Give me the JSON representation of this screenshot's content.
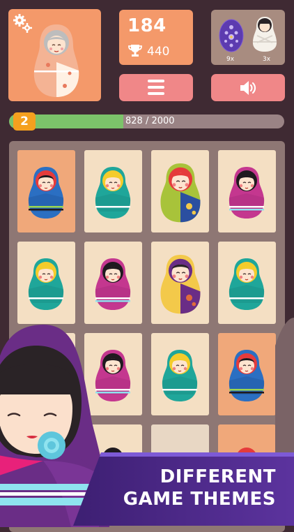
{
  "stats": {
    "score": "184",
    "best": "440"
  },
  "powerups": [
    {
      "name": "purple-egg",
      "count": "9x"
    },
    {
      "name": "white-doll",
      "count": "3x"
    }
  ],
  "level": {
    "number": "2",
    "progress_text": "828 / 2000",
    "progress_fraction": 0.414
  },
  "icons": {
    "settings": "gear-icon",
    "menu": "hamburger-icon",
    "sound": "speaker-icon",
    "trophy": "trophy-icon"
  },
  "banner": {
    "line1": "DIFFERENT",
    "line2": "GAME THEMES"
  },
  "board": {
    "rows": [
      [
        {
          "bg": "orange",
          "doll": "blue-red"
        },
        {
          "bg": "cream",
          "doll": "teal-blonde"
        },
        {
          "bg": "cream",
          "doll": "green-red-big"
        },
        {
          "bg": "cream",
          "doll": "pink-black"
        }
      ],
      [
        {
          "bg": "cream",
          "doll": "teal-blonde"
        },
        {
          "bg": "cream",
          "doll": "pink-black"
        },
        {
          "bg": "cream",
          "doll": "purple-big"
        },
        {
          "bg": "cream",
          "doll": "teal-blonde"
        }
      ],
      [
        {
          "bg": "cream",
          "doll": "hidden"
        },
        {
          "bg": "cream",
          "doll": "pink-black"
        },
        {
          "bg": "cream",
          "doll": "teal-blonde"
        },
        {
          "bg": "orange",
          "doll": "blue-red"
        }
      ],
      [
        {
          "bg": "cream",
          "doll": "hidden"
        },
        {
          "bg": "cream",
          "doll": "partial-black"
        },
        {
          "bg": "blank",
          "doll": "none"
        },
        {
          "bg": "orange",
          "doll": "partial-red"
        }
      ]
    ]
  },
  "colors": {
    "background": "#3f2a33",
    "panel_orange": "#f4996a",
    "button_pink": "#f08788",
    "progress_green": "#7cc36a",
    "level_badge": "#f5a01f",
    "banner_purple": "#4b2a86"
  }
}
